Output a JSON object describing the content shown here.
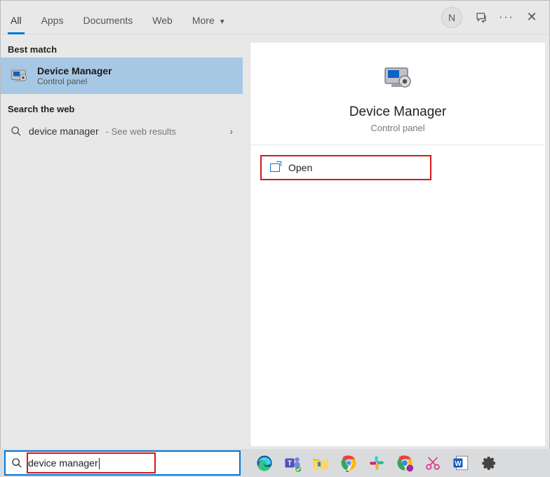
{
  "tabs": {
    "all": "All",
    "apps": "Apps",
    "documents": "Documents",
    "web": "Web",
    "more": "More"
  },
  "avatar": "N",
  "sections": {
    "best": "Best match",
    "web": "Search the web"
  },
  "best_match": {
    "title": "Device Manager",
    "subtitle": "Control panel"
  },
  "web_result": {
    "query": "device manager",
    "suffix": " - See web results"
  },
  "preview": {
    "title": "Device Manager",
    "subtitle": "Control panel",
    "open": "Open"
  },
  "search_value": "device manager"
}
